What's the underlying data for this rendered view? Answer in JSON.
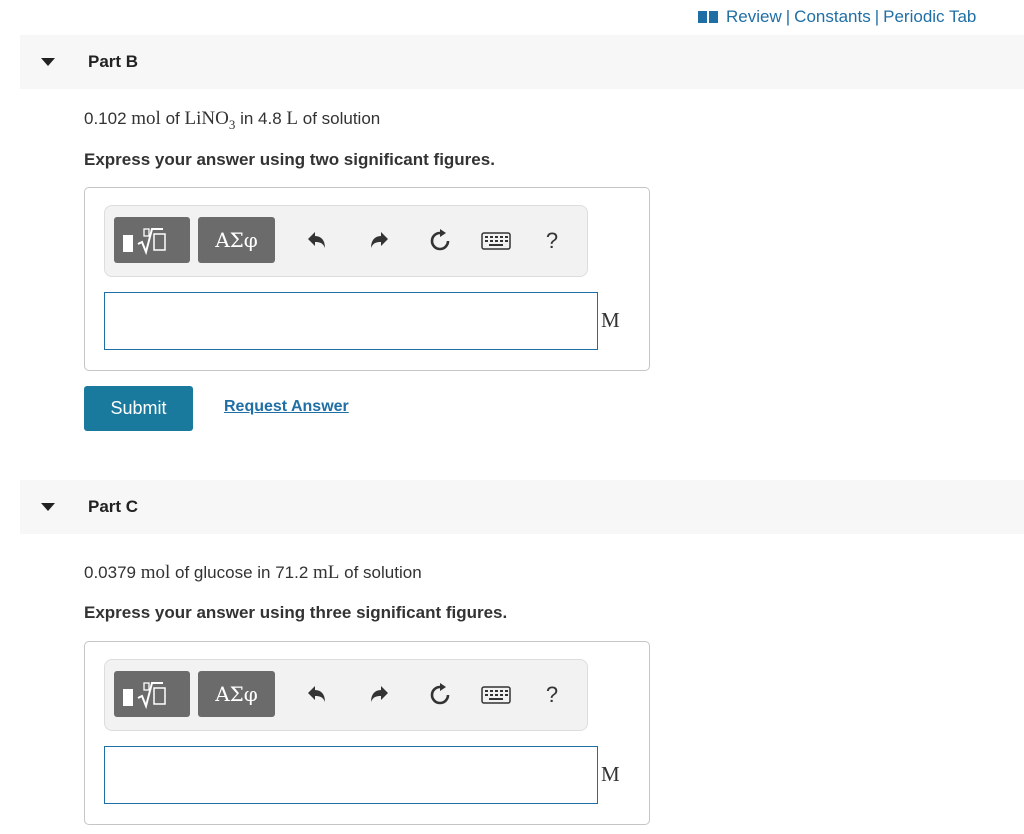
{
  "top_links": [
    "Review",
    "Constants",
    "Periodic Tab"
  ],
  "colors": {
    "link": "#1f6fa5",
    "submit": "#1a7a9e",
    "toolbar_button": "#6b6b6b"
  },
  "icons": {
    "book": "book-icon",
    "templates": "templates-sqrt-icon",
    "undo": "undo-icon",
    "redo": "redo-icon",
    "reset": "reset-icon",
    "keyboard": "keyboard-icon"
  },
  "part_b": {
    "title": "Part B",
    "q_amount": "0.102",
    "q_unit": "mol",
    "q_of": "of",
    "q_formula": "LiNO",
    "q_subscript": "3",
    "q_in": "in 4.8",
    "q_vol_unit": "L",
    "q_tail": "of solution",
    "instruction": "Express your answer using two significant figures.",
    "symbols_label": "ΑΣφ",
    "help_label": "?",
    "answer_value": "",
    "unit": "M",
    "submit_label": "Submit",
    "request_label": "Request Answer"
  },
  "part_c": {
    "title": "Part C",
    "q_amount": "0.0379",
    "q_unit": "mol",
    "q_middle": "of glucose in 71.2",
    "q_vol_unit": "mL",
    "q_tail": "of solution",
    "instruction": "Express your answer using three significant figures.",
    "symbols_label": "ΑΣφ",
    "help_label": "?",
    "answer_value": "",
    "unit": "M"
  }
}
